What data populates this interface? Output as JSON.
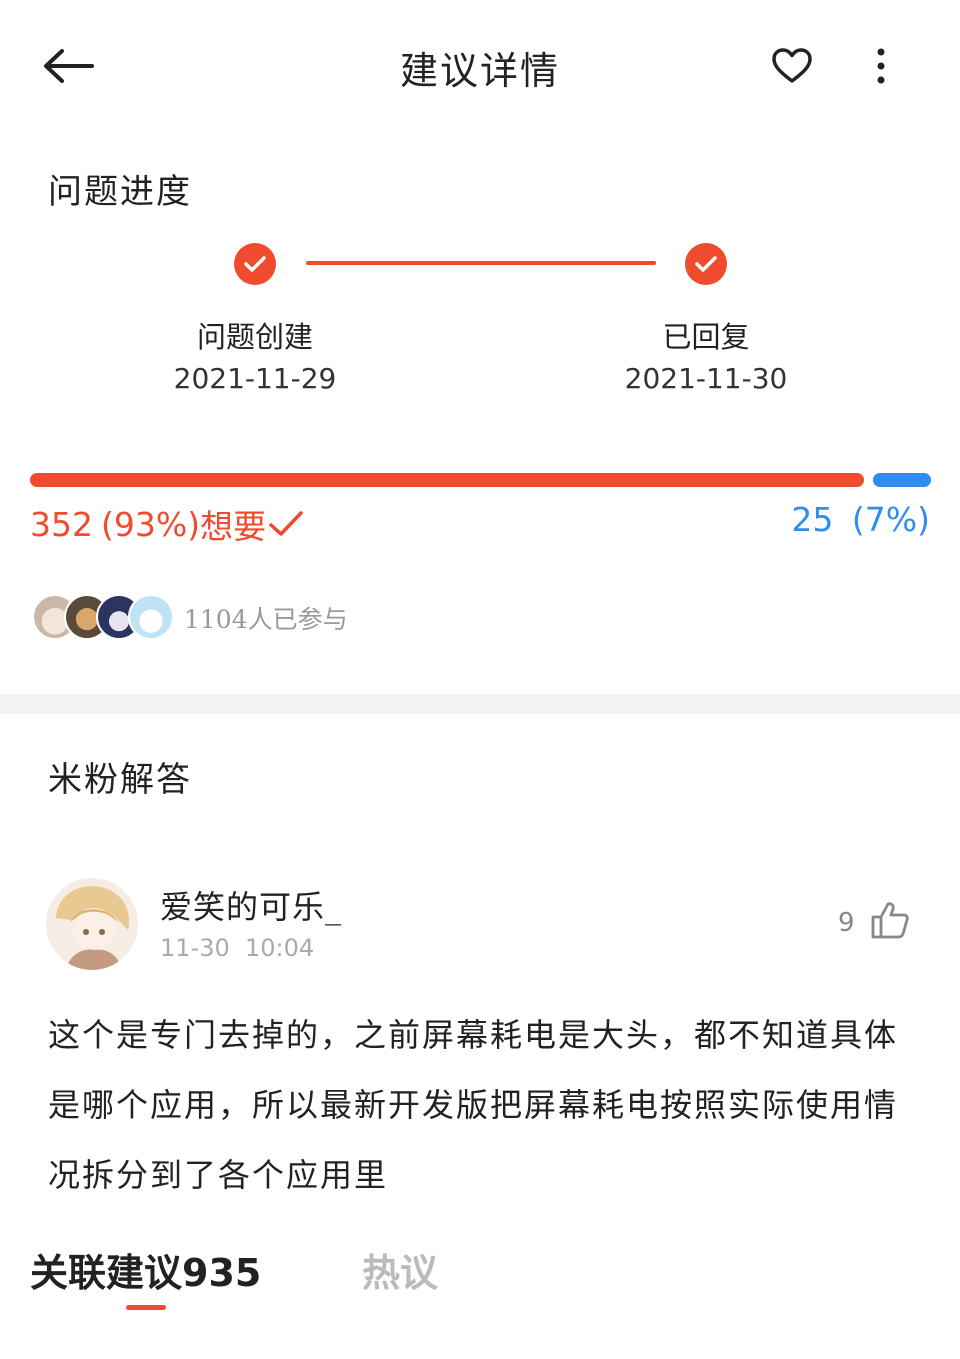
{
  "header": {
    "title": "建议详情"
  },
  "progress": {
    "section_title": "问题进度",
    "steps": [
      {
        "label": "问题创建",
        "date": "2021-11-29"
      },
      {
        "label": "已回复",
        "date": "2021-11-30"
      }
    ]
  },
  "vote": {
    "want_count": "352",
    "want_percent": "(93%)",
    "want_label": "想要",
    "want_fraction": 0.93,
    "not_want_count": "25",
    "not_want_percent": "(7%)",
    "want_color": "#f04b2f",
    "not_want_color": "#2f8cf0"
  },
  "participants": {
    "text": "1104人已参与"
  },
  "answers": {
    "section_title": "米粉解答",
    "items": [
      {
        "username": "爱笑的可乐_",
        "time": "11-30  10:04",
        "likes": "9",
        "content": "这个是专门去掉的，之前屏幕耗电是大头，都不知道具体是哪个应用，所以最新开发版把屏幕耗电按照实际使用情况拆分到了各个应用里"
      }
    ]
  },
  "tabs": [
    {
      "label": "关联建议935",
      "active": true
    },
    {
      "label": "热议",
      "active": false
    }
  ]
}
